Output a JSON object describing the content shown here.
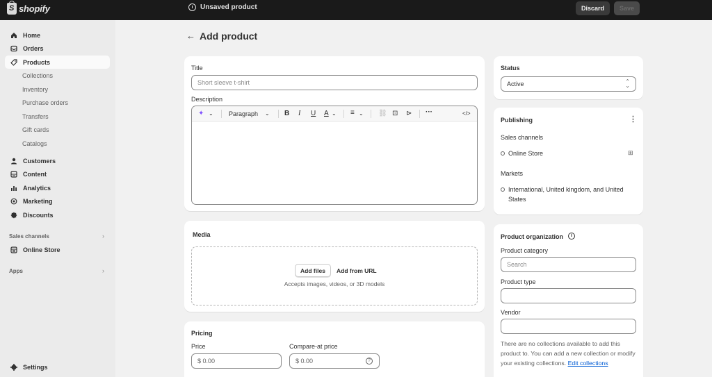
{
  "topbar": {
    "logo_text": "shopify",
    "unsaved_label": "Unsaved product",
    "discard_label": "Discard",
    "save_label": "Save"
  },
  "sidebar": {
    "items": [
      {
        "label": "Home",
        "icon": "home-icon"
      },
      {
        "label": "Orders",
        "icon": "orders-icon"
      },
      {
        "label": "Products",
        "icon": "tag-icon",
        "active": true
      }
    ],
    "product_sub": [
      "Collections",
      "Inventory",
      "Purchase orders",
      "Transfers",
      "Gift cards",
      "Catalogs"
    ],
    "items2": [
      {
        "label": "Customers",
        "icon": "person-icon"
      },
      {
        "label": "Content",
        "icon": "content-icon"
      },
      {
        "label": "Analytics",
        "icon": "bar-chart-icon"
      },
      {
        "label": "Marketing",
        "icon": "target-icon"
      },
      {
        "label": "Discounts",
        "icon": "discount-icon"
      }
    ],
    "sales_channels_label": "Sales channels",
    "online_store_label": "Online Store",
    "apps_label": "Apps",
    "settings_label": "Settings"
  },
  "page": {
    "title": "Add product"
  },
  "product": {
    "title_label": "Title",
    "title_placeholder": "Short sleeve t-shirt",
    "description_label": "Description",
    "paragraph_label": "Paragraph"
  },
  "media": {
    "heading": "Media",
    "add_files": "Add files",
    "add_from_url": "Add from URL",
    "accepts": "Accepts images, videos, or 3D models"
  },
  "pricing": {
    "heading": "Pricing",
    "price_label": "Price",
    "price_value": "$  0.00",
    "compare_label": "Compare-at price",
    "compare_value": "$  0.00"
  },
  "status": {
    "heading": "Status",
    "value": "Active"
  },
  "publishing": {
    "heading": "Publishing",
    "sales_channels_label": "Sales channels",
    "channel": "Online Store",
    "markets_label": "Markets",
    "markets_line1": "International, United kingdom, and United",
    "markets_line2": "States"
  },
  "organization": {
    "heading": "Product organization",
    "category_label": "Product category",
    "category_placeholder": "Search",
    "type_label": "Product type",
    "vendor_label": "Vendor",
    "collections_note": "There are no collections available to add this product to. You can add a new collection or modify your existing collections.",
    "edit_link": "Edit collections"
  }
}
